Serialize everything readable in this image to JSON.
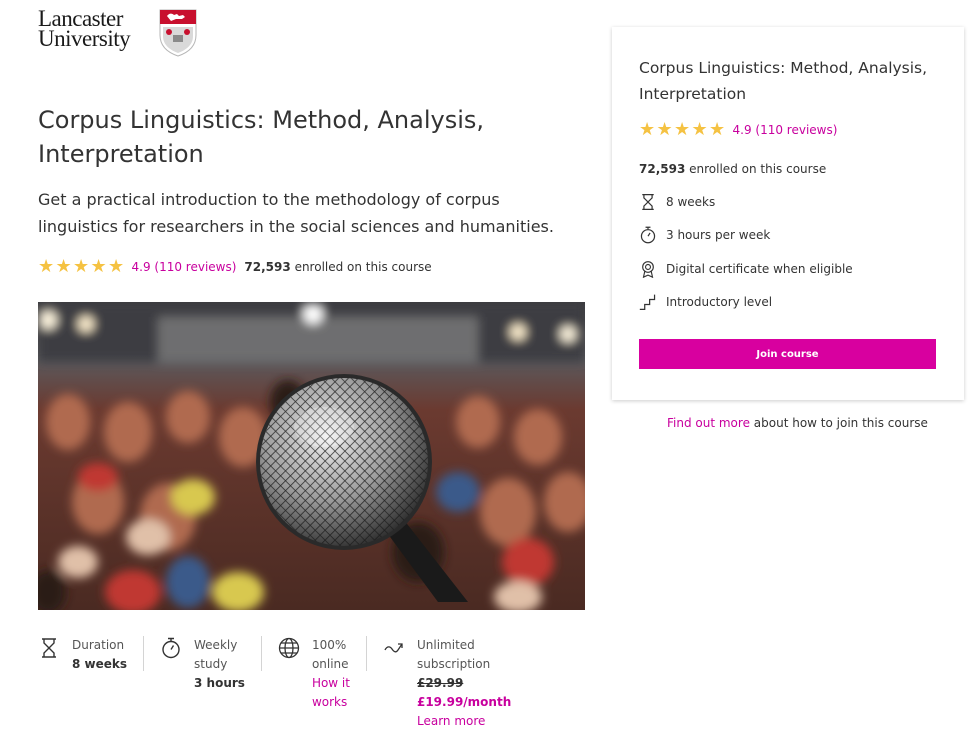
{
  "logo": {
    "line1": "Lancaster",
    "line2": "University"
  },
  "course": {
    "title": "Corpus Linguistics: Method, Analysis, Interpretation",
    "description": "Get a practical introduction to the methodology of corpus linguistics for researchers in the social sciences and humanities.",
    "rating_text": "4.9 (110 reviews)",
    "stars": 5,
    "enrolled_count": "72,593",
    "enrolled_suffix": "enrolled on this course"
  },
  "stats": {
    "duration": {
      "label": "Duration",
      "value": "8 weeks",
      "icon": "hourglass-icon"
    },
    "weekly": {
      "label_line1": "Weekly",
      "label_line2": "study",
      "value": "3 hours",
      "icon": "stopwatch-icon"
    },
    "online": {
      "label_line1": "100%",
      "label_line2": "online",
      "link_line1": "How it",
      "link_line2": "works",
      "icon": "globe-icon"
    },
    "subscription": {
      "label_line1": "Unlimited",
      "label_line2": "subscription",
      "old_price": "£29.99",
      "new_price": "£19.99/month",
      "link": "Learn more",
      "icon": "infinity-arrow-icon"
    }
  },
  "card": {
    "title": "Corpus Linguistics: Method, Analysis, Interpretation",
    "rating_text": "4.9 (110 reviews)",
    "enrolled_count": "72,593",
    "enrolled_suffix": "enrolled on this course",
    "features": [
      {
        "text": "8 weeks",
        "icon": "hourglass-icon"
      },
      {
        "text": "3 hours per week",
        "icon": "stopwatch-icon"
      },
      {
        "text": "Digital certificate when eligible",
        "icon": "certificate-icon"
      },
      {
        "text": "Introductory level",
        "icon": "steps-icon"
      }
    ],
    "join_label": "Join course"
  },
  "find_out": {
    "link": "Find out more",
    "rest": "about how to join this course"
  },
  "colors": {
    "accent": "#d8009f",
    "link": "#c8009e",
    "star": "#f5c242",
    "crest_red": "#c8102e"
  }
}
